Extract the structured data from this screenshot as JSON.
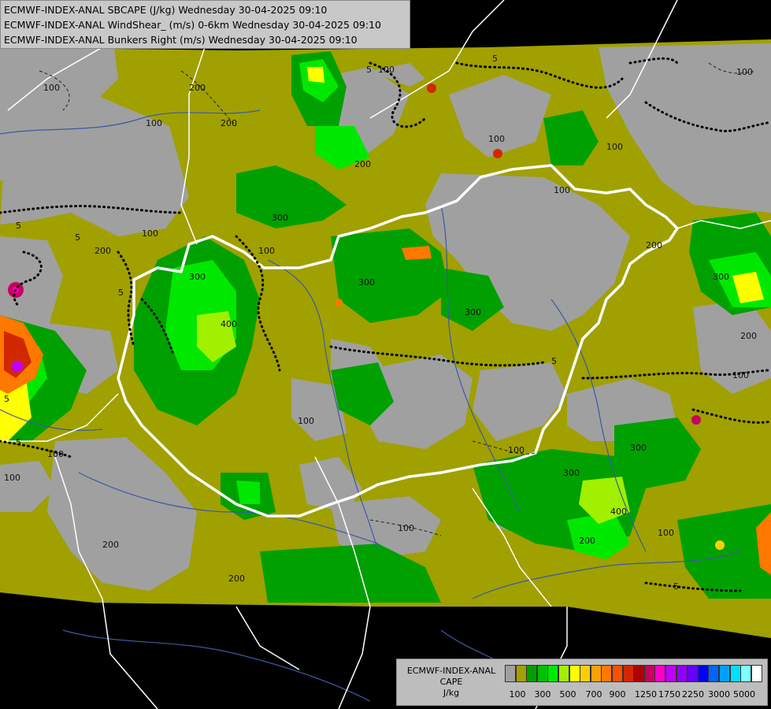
{
  "header": {
    "line1": "ECMWF-INDEX-ANAL SBCAPE (J/kg) Wednesday 30-04-2025 09:10",
    "line2": "ECMWF-INDEX-ANAL WindShear_ (m/s) 0-6km Wednesday 30-04-2025 09:10",
    "line3": "ECMWF-INDEX-ANAL Bunkers Right (m/s) Wednesday 30-04-2025 09:10"
  },
  "legend": {
    "line1": "ECMWF-INDEX-ANAL",
    "line2": "CAPE",
    "line3": "J/kg",
    "colors": [
      "#a0a0a0",
      "#a0a000",
      "#00a000",
      "#00c000",
      "#00e800",
      "#a0f000",
      "#ffff00",
      "#ffd000",
      "#ffa000",
      "#ff7800",
      "#ff5000",
      "#d22800",
      "#b00000",
      "#c80060",
      "#ff00c8",
      "#c000ff",
      "#8c00ff",
      "#6400ff",
      "#0000ff",
      "#0064ff",
      "#00a0ff",
      "#00e0ff",
      "#80ffff",
      "#ffffff"
    ],
    "ticks": [
      "100",
      "300",
      "500",
      "700",
      "900",
      "1250",
      "1750",
      "2250",
      "3000",
      "5000"
    ]
  },
  "contours": {
    "labels": [
      "100",
      "100",
      "100",
      "100",
      "100",
      "100",
      "100",
      "100",
      "100",
      "100",
      "100",
      "100",
      "100",
      "100",
      "100",
      "100",
      "200",
      "200",
      "200",
      "200",
      "200",
      "200",
      "200",
      "200",
      "200",
      "300",
      "300",
      "300",
      "300",
      "300",
      "300",
      "300",
      "400",
      "400",
      "5",
      "5",
      "5",
      "5",
      "5",
      "5",
      "5",
      "5",
      "5"
    ]
  },
  "map": {
    "background": "#000000",
    "grey": "#a0a0a0",
    "olive": "#a0a000",
    "border": "#ffffff",
    "rivers": "#3c5aa0"
  }
}
